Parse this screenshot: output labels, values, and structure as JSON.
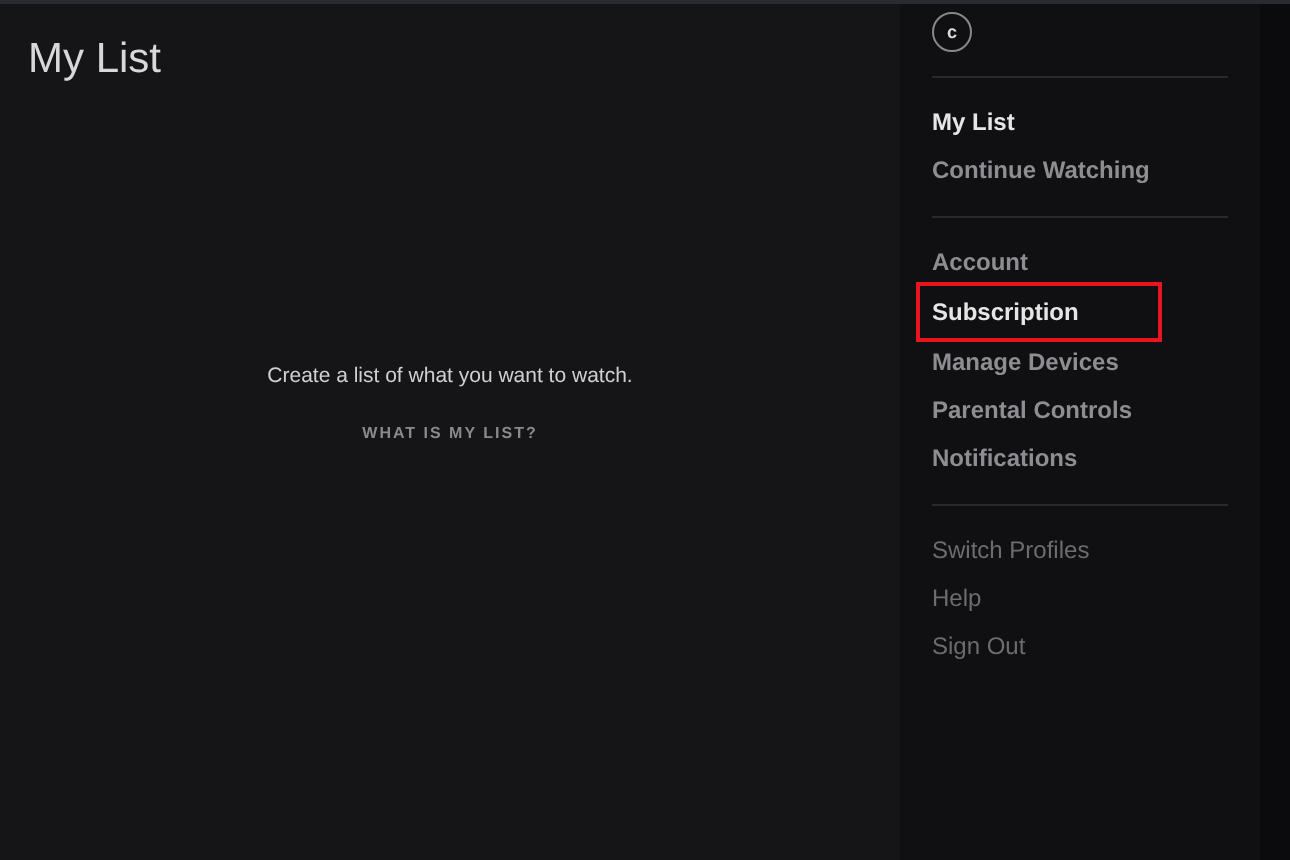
{
  "page_title": "My List",
  "empty_state": {
    "message": "Create a list of what you want to watch.",
    "link": "WHAT IS MY LIST?"
  },
  "profile": {
    "initial": "c"
  },
  "menu_groups": [
    {
      "kind": "strong",
      "items": [
        {
          "label": "My List",
          "selected": true,
          "highlighted": false
        },
        {
          "label": "Continue Watching",
          "selected": false,
          "highlighted": false
        }
      ]
    },
    {
      "kind": "strong",
      "items": [
        {
          "label": "Account",
          "selected": false,
          "highlighted": false
        },
        {
          "label": "Subscription",
          "selected": true,
          "highlighted": true
        },
        {
          "label": "Manage Devices",
          "selected": false,
          "highlighted": false
        },
        {
          "label": "Parental Controls",
          "selected": false,
          "highlighted": false
        },
        {
          "label": "Notifications",
          "selected": false,
          "highlighted": false
        }
      ]
    },
    {
      "kind": "muted",
      "items": [
        {
          "label": "Switch Profiles",
          "selected": false,
          "highlighted": false
        },
        {
          "label": "Help",
          "selected": false,
          "highlighted": false
        },
        {
          "label": "Sign Out",
          "selected": false,
          "highlighted": false
        }
      ]
    }
  ]
}
